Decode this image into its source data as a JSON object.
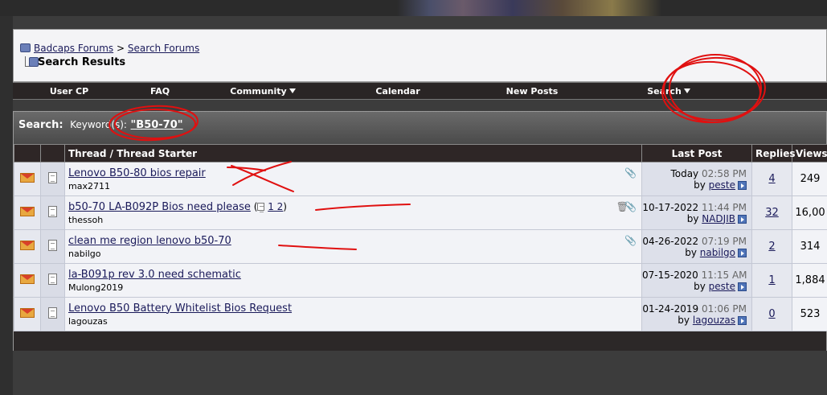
{
  "breadcrumb": {
    "root": "Badcaps Forums",
    "separator": ">",
    "parent": "Search Forums",
    "current": "Search Results"
  },
  "navbar": {
    "items": [
      "User CP",
      "FAQ",
      "Community",
      "Calendar",
      "New Posts",
      "Search"
    ]
  },
  "search": {
    "label": "Search:",
    "keyword_label": "Keyword(s):",
    "keyword_value": "\"B50-70\""
  },
  "table": {
    "headers": {
      "thread": "Thread / Thread Starter",
      "last_post": "Last Post",
      "replies": "Replies",
      "views": "Views"
    },
    "rows": [
      {
        "title": "Lenovo B50-80 bios repair",
        "starter": "max2711",
        "pages": "",
        "date": "Today",
        "time": "02:58 PM",
        "by": "peste",
        "replies": "4",
        "views": "249"
      },
      {
        "title": "b50-70 LA-B092P Bios need please",
        "starter": "thessoh",
        "pages": "1 2",
        "date": "10-17-2022",
        "time": "11:44 PM",
        "by": "NADJIB",
        "replies": "32",
        "views": "16,00"
      },
      {
        "title": "clean me region lenovo b50-70",
        "starter": "nabilgo",
        "pages": "",
        "date": "04-26-2022",
        "time": "07:19 PM",
        "by": "nabilgo",
        "replies": "2",
        "views": "314"
      },
      {
        "title": "la-B091p rev 3.0 need schematic",
        "starter": "Mulong2019",
        "pages": "",
        "date": "07-15-2020",
        "time": "11:15 AM",
        "by": "peste",
        "replies": "1",
        "views": "1,884"
      },
      {
        "title": "Lenovo B50 Battery Whitelist Bios Request",
        "starter": "lagouzas",
        "pages": "",
        "date": "01-24-2019",
        "time": "01:06 PM",
        "by": "lagouzas",
        "replies": "0",
        "views": "523"
      }
    ]
  },
  "by_label": "by",
  "colors": {
    "annotation": "#e01010",
    "navbar": "#2a2525",
    "link": "#1a1a5a"
  }
}
